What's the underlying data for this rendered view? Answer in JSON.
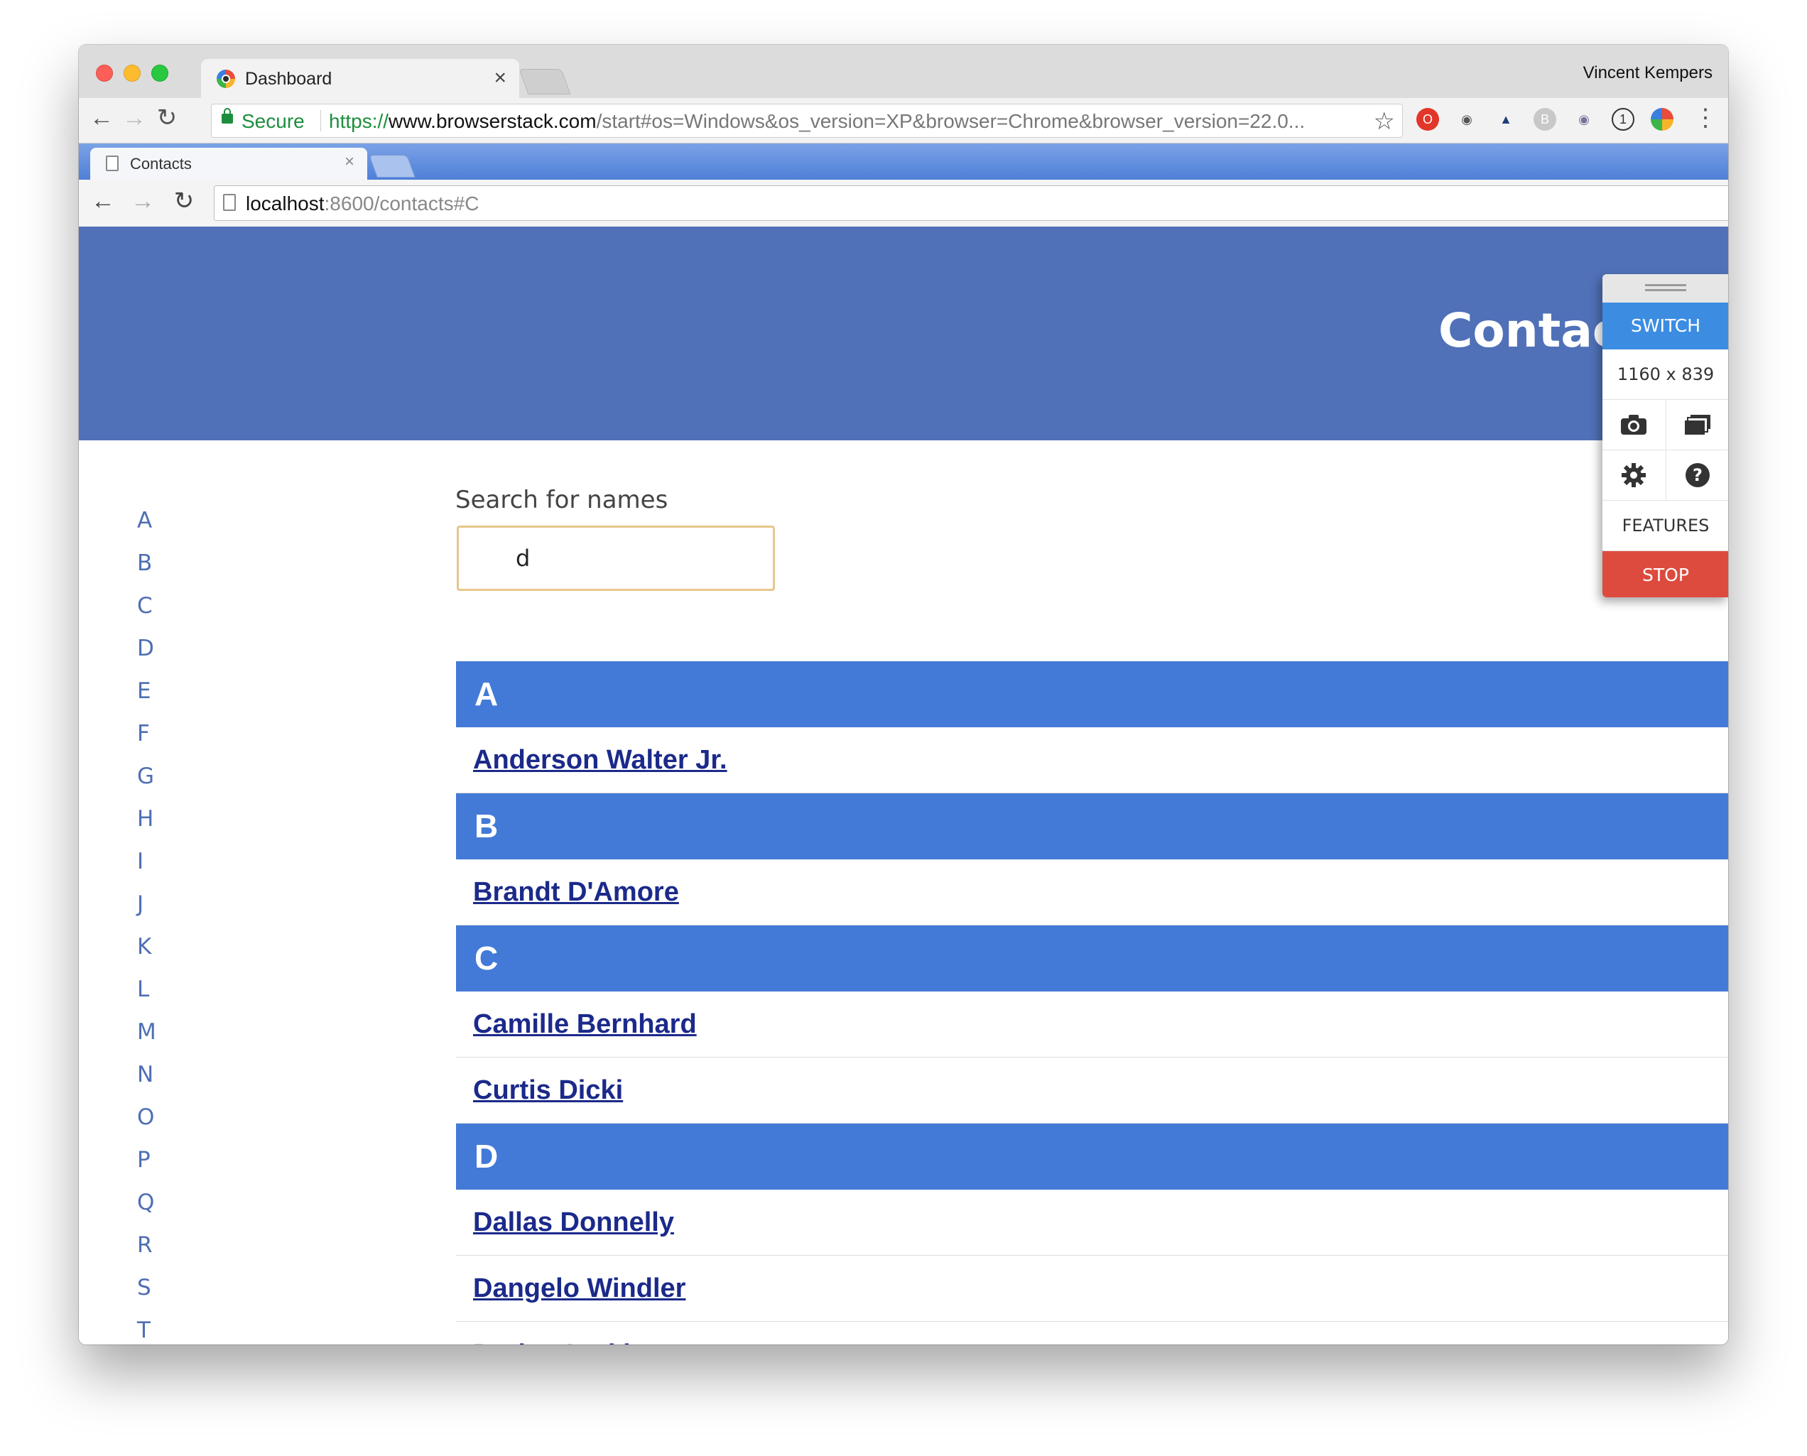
{
  "browser": {
    "tab_title": "Dashboard",
    "tab_close": "×",
    "profile_name": "Vincent Kempers",
    "secure_label": "Secure",
    "url_scheme": "https://",
    "url_host": "www.browserstack.com",
    "url_path": "/start#os=Windows&os_version=XP&browser=Chrome&browser_version=22.0...",
    "extensions": [
      "opera-icon",
      "glasses-icon",
      "axe-icon",
      "b-icon",
      "cat-icon",
      "1password-icon",
      "chrome-icon"
    ]
  },
  "inner_browser": {
    "tab_title": "Contacts",
    "tab_close": "×",
    "url_host": "localhost",
    "url_path": ":8600/contacts#C"
  },
  "page": {
    "title": "Contact",
    "alphabet": [
      "A",
      "B",
      "C",
      "D",
      "E",
      "F",
      "G",
      "H",
      "I",
      "J",
      "K",
      "L",
      "M",
      "N",
      "O",
      "P",
      "Q",
      "R",
      "S",
      "T"
    ],
    "search": {
      "label": "Search for names",
      "value": "d"
    },
    "groups": [
      {
        "letter": "A",
        "contacts": [
          "Anderson Walter Jr."
        ]
      },
      {
        "letter": "B",
        "contacts": [
          "Brandt D'Amore"
        ]
      },
      {
        "letter": "C",
        "contacts": [
          "Camille Bernhard",
          "Curtis Dicki"
        ]
      },
      {
        "letter": "D",
        "contacts": [
          "Dallas Donnelly",
          "Dangelo Windler",
          "Darion Larkin"
        ]
      }
    ]
  },
  "panel": {
    "switch_label": "SWITCH",
    "resolution": "1160 x 839",
    "features_label": "FEATURES",
    "stop_label": "STOP"
  },
  "colors": {
    "hero": "#5071b8",
    "group_header": "#437ad7",
    "link": "#1b2a8a",
    "switch": "#3c8de2",
    "stop": "#dd4b3e"
  }
}
